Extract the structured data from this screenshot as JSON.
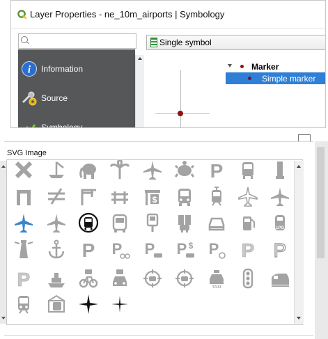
{
  "window": {
    "title": "Layer Properties - ne_10m_airports | Symbology"
  },
  "search": {
    "placeholder": ""
  },
  "sidebar": {
    "items": [
      {
        "label": "Information",
        "icon": "information-icon"
      },
      {
        "label": "Source",
        "icon": "source-settings-icon"
      },
      {
        "label": "Symbology",
        "icon": "symbology-icon"
      }
    ]
  },
  "symbology": {
    "renderer_label": "Single symbol",
    "tree": [
      {
        "label": "Marker",
        "level": 0,
        "selected": false
      },
      {
        "label": "Simple marker",
        "level": 1,
        "selected": true
      }
    ],
    "marker_color": "#8c1414"
  },
  "svg_panel": {
    "label": "SVG Image",
    "icons": [
      [
        "cross-icon",
        "boat-crane-icon",
        "elephant-icon",
        "palm-icon",
        "airplane-icon",
        "turtle-icon",
        "parking-icon",
        "bus-icon",
        "post-icon"
      ],
      [
        "gate-icon",
        "not-equal-icon",
        "crane-icon",
        "bridge-icon",
        "toll-icon",
        "bus-front-icon",
        "tram-icon",
        "airplane-outline-icon",
        "airplane-icon"
      ],
      [
        "airplane-blue-icon",
        "airplane-icon",
        "bus-circle-icon",
        "bus-outline-icon",
        "bus-stop-icon",
        "charging-station-icon",
        "car-icon",
        "fuel-icon",
        "lpg-icon"
      ],
      [
        "lighthouse-icon",
        "anchor-icon",
        "parking-icon",
        "parking-bike-icon",
        "parking-car-icon",
        "parking-paid-icon",
        "parking-disabled-icon",
        "parking-pattern-icon",
        "parking-outline-icon"
      ],
      [
        "parking-pattern-icon",
        "ship-icon",
        "bicycle-rental-icon",
        "car-rental-icon",
        "car-target-icon",
        "car-target-icon",
        "taxi-icon",
        "traffic-light-icon",
        "train-icon"
      ],
      [
        "train-front-icon",
        "tram-stop-icon",
        "star-four-point-icon",
        "cross-thin-icon"
      ]
    ],
    "selected_icon": "bus-circle-icon",
    "accent": "#2f7fd6"
  }
}
